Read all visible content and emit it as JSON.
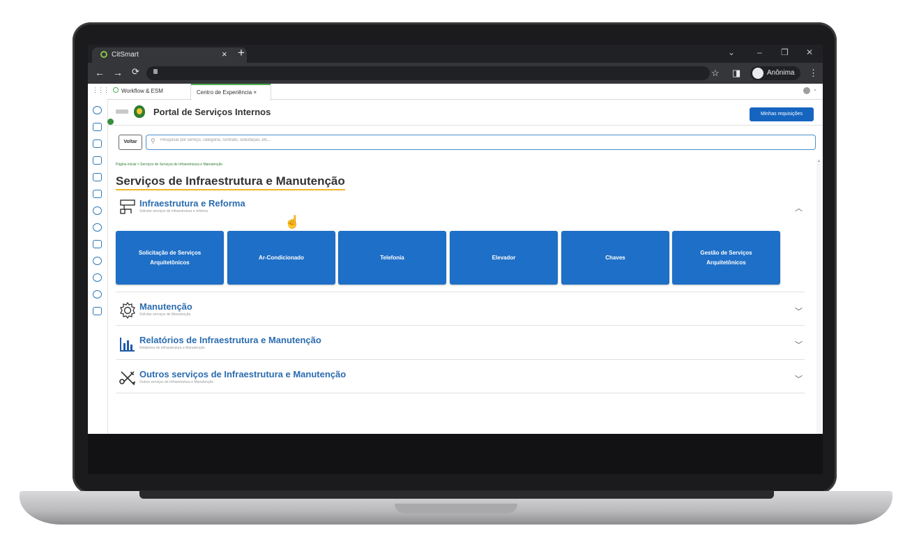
{
  "browser": {
    "tab_title": "CitSmart",
    "tab_close": "×",
    "new_tab": "+",
    "profile_label": "Anônima"
  },
  "app": {
    "tabs": [
      {
        "label": "Workflow & ESM"
      },
      {
        "label": "Centro de Experiência ×"
      }
    ],
    "portal_title": "Portal de Serviços Internos",
    "minhas_label": "Minhas requisições",
    "voltar_label": "Voltar",
    "search_placeholder": "Pesquisar por serviço, categoria, contrato, solicitação, etc...",
    "breadcrumb": "Página inicial > Serviços de Serviços de Infraestrutura e Manutenção",
    "page_title": "Serviços de Infraestrutura e Manutenção"
  },
  "sections": [
    {
      "name": "Infraestrutura e Reforma",
      "sub": "Solicitar serviços de infraestrutura e reforma",
      "icon": "building-icon",
      "expanded": true
    },
    {
      "name": "Manutenção",
      "sub": "Solicitar serviços de Manutenção",
      "icon": "gear-icon",
      "expanded": false
    },
    {
      "name": "Relatórios de Infraestrutura e Manutenção",
      "sub": "Relatórios de Infraestrutura e Manutenção",
      "icon": "bar-chart-icon",
      "expanded": false
    },
    {
      "name": "Outros serviços de Infraestrutura e Manutenção",
      "sub": "Outros serviços de Infraestrutura e Manutenção",
      "icon": "tools-icon",
      "expanded": false
    }
  ],
  "cards": [
    {
      "label": "Solicitação de Serviços Arquitetônicos"
    },
    {
      "label": "Ar-Condicionado"
    },
    {
      "label": "Telefonia"
    },
    {
      "label": "Elevador"
    },
    {
      "label": "Chaves"
    },
    {
      "label": "Gestão de Serviços Arquitetônicos"
    }
  ],
  "colors": {
    "accent": "#1e6fc7",
    "title_underline": "#f0b429",
    "breadcrumb": "#2e7d32"
  }
}
